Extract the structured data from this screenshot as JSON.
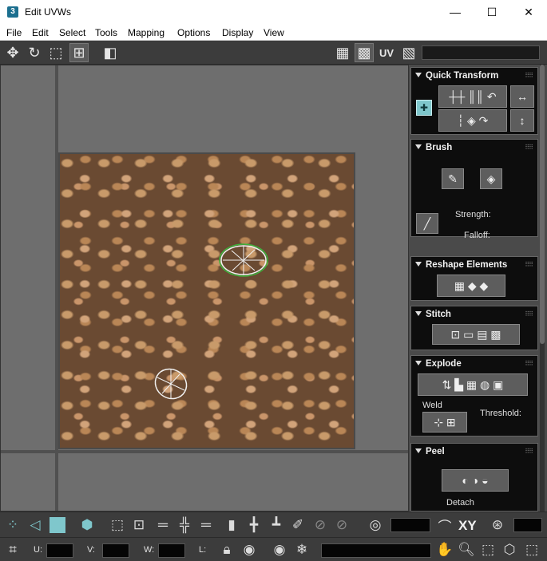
{
  "window": {
    "title": "Edit UVWs",
    "app_icon_text": "3",
    "minimize": "—",
    "maximize": "☐",
    "close": "✕"
  },
  "menubar": {
    "items": [
      "File",
      "Edit",
      "Select",
      "Tools",
      "Mapping",
      "Options",
      "Display",
      "View"
    ]
  },
  "toolbar": {
    "uv_label": "UV"
  },
  "panel": {
    "quick_transform": {
      "title": "Quick Transform"
    },
    "brush": {
      "title": "Brush",
      "strength_label": "Strength:",
      "falloff_label": "Falloff:"
    },
    "reshape": {
      "title": "Reshape Elements"
    },
    "stitch": {
      "title": "Stitch"
    },
    "explode": {
      "title": "Explode",
      "weld_label": "Weld",
      "threshold_label": "Threshold:"
    },
    "peel": {
      "title": "Peel",
      "detach_label": "Detach"
    }
  },
  "bottombar": {
    "xy_label": "XY",
    "u_label": "U:",
    "v_label": "V:",
    "w_label": "W:",
    "l_label": "L:"
  },
  "colors": {
    "accent_teal": "#7fc7cc",
    "ui_dark": "#3c3c3c",
    "viewport_bg": "#6e6e6e"
  }
}
